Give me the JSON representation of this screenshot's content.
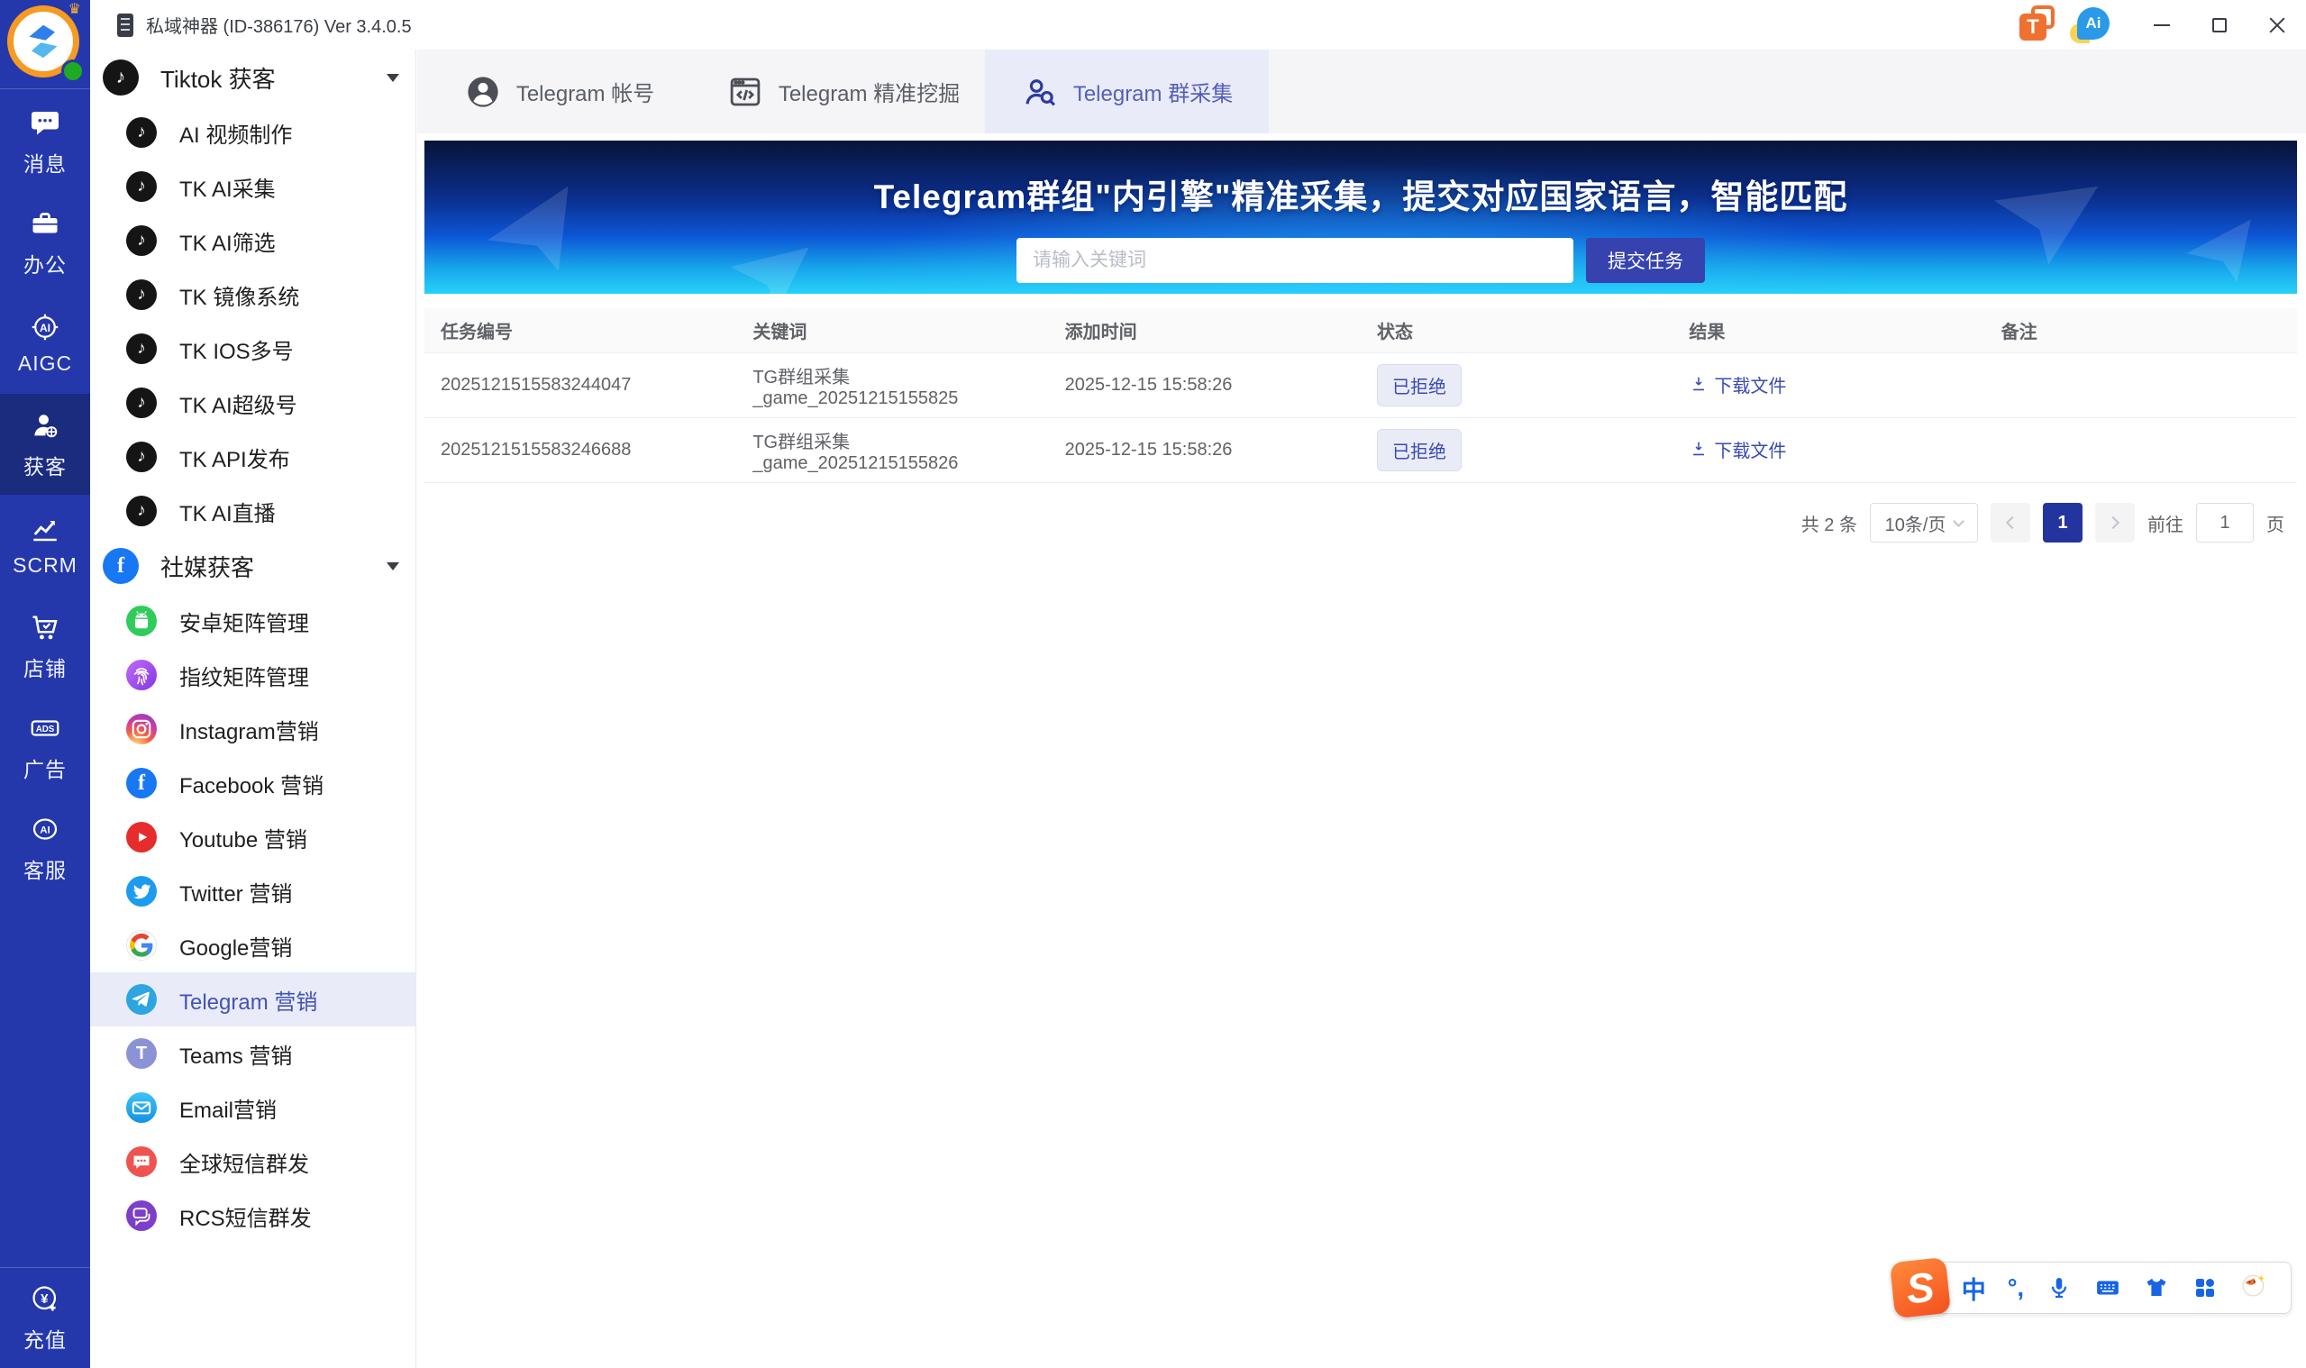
{
  "titlebar": {
    "title": "私域神器 (ID-386176) Ver 3.4.0.5"
  },
  "rail": {
    "items": [
      {
        "label": "消息",
        "icon": "chat"
      },
      {
        "label": "办公",
        "icon": "briefcase"
      },
      {
        "label": "AIGC",
        "icon": "ai-badge"
      },
      {
        "label": "获客",
        "icon": "person-globe",
        "active": true
      },
      {
        "label": "SCRM",
        "icon": "line-chart"
      },
      {
        "label": "店铺",
        "icon": "cart"
      },
      {
        "label": "广告",
        "icon": "ads"
      },
      {
        "label": "客服",
        "icon": "ai-service"
      }
    ],
    "bottom": {
      "label": "充值",
      "icon": "yuan-recharge"
    }
  },
  "sidebar": {
    "groups": [
      {
        "label": "Tiktok 获客",
        "items": [
          {
            "label": "AI 视频制作"
          },
          {
            "label": "TK AI采集"
          },
          {
            "label": "TK AI筛选"
          },
          {
            "label": "TK 镜像系统"
          },
          {
            "label": "TK IOS多号"
          },
          {
            "label": "TK AI超级号"
          },
          {
            "label": "TK API发布"
          },
          {
            "label": "TK AI直播"
          }
        ]
      },
      {
        "label": "社媒获客",
        "items": [
          {
            "label": "安卓矩阵管理"
          },
          {
            "label": "指纹矩阵管理"
          },
          {
            "label": "Instagram营销"
          },
          {
            "label": "Facebook 营销"
          },
          {
            "label": "Youtube 营销"
          },
          {
            "label": "Twitter 营销"
          },
          {
            "label": "Google营销"
          },
          {
            "label": "Telegram 营销",
            "active": true
          },
          {
            "label": "Teams 营销"
          },
          {
            "label": "Email营销"
          },
          {
            "label": "全球短信群发"
          },
          {
            "label": "RCS短信群发"
          }
        ]
      }
    ]
  },
  "tabs": [
    {
      "label": "Telegram 帐号"
    },
    {
      "label": "Telegram 精准挖掘"
    },
    {
      "label": "Telegram 群采集",
      "active": true
    }
  ],
  "banner": {
    "title": "Telegram群组\"内引擎\"精准采集，提交对应国家语言，智能匹配",
    "placeholder": "请输入关键词",
    "submit_label": "提交任务"
  },
  "table": {
    "headers": [
      "任务编号",
      "关键词",
      "添加时间",
      "状态",
      "结果",
      "备注"
    ],
    "rows": [
      {
        "task_id": "2025121515583244047",
        "keyword": "TG群组采集_game_20251215155825",
        "added_time": "2025-12-15 15:58:26",
        "status": "已拒绝",
        "result": "下载文件",
        "remark": ""
      },
      {
        "task_id": "2025121515583246688",
        "keyword": "TG群组采集_game_20251215155826",
        "added_time": "2025-12-15 15:58:26",
        "status": "已拒绝",
        "result": "下载文件",
        "remark": ""
      }
    ]
  },
  "pagination": {
    "total": "共 2 条",
    "page_size": "10条/页",
    "current_page": "1",
    "goto_label": "前往",
    "goto_value": "1",
    "page_unit": "页"
  },
  "icon_glyphs": {
    "ai": "AI",
    "ads": "ADS",
    "yuan": "¥",
    "tiktok_note": "♪",
    "facebook_f": "f",
    "teams_t": "T",
    "sogou_s": "S",
    "ime_lang": "中",
    "ime_punct": "°,",
    "tray_t": "T",
    "tray_ai": "Ai"
  }
}
